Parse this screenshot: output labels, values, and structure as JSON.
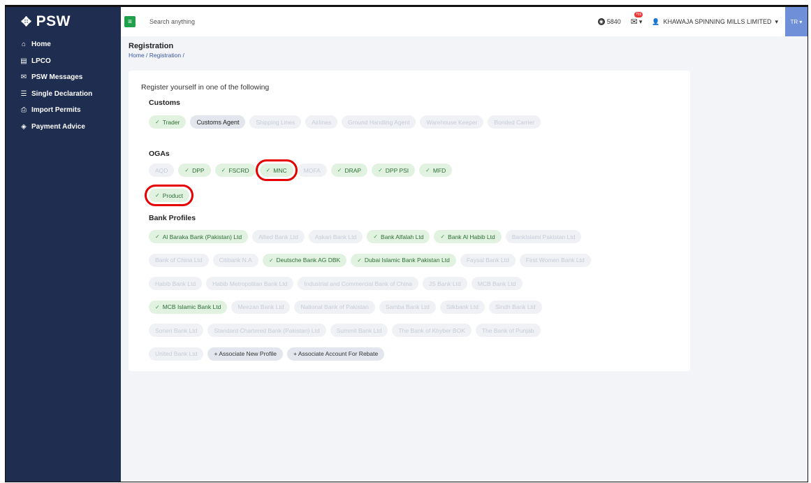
{
  "sidebar": {
    "logo": "PSW",
    "items": [
      {
        "icon": "home-icon",
        "glyph": "⌂",
        "label": "Home"
      },
      {
        "icon": "document-icon",
        "glyph": "▤",
        "label": "LPCO"
      },
      {
        "icon": "messages-icon",
        "glyph": "✉",
        "label": "PSW Messages"
      },
      {
        "icon": "declaration-icon",
        "glyph": "☰",
        "label": "Single Declaration"
      },
      {
        "icon": "import-icon",
        "glyph": "⎙",
        "label": "Import Permits"
      },
      {
        "icon": "payment-icon",
        "glyph": "◈",
        "label": "Payment Advice"
      }
    ]
  },
  "topbar": {
    "search_placeholder": "Search anything",
    "coins": "5840",
    "notification_badge": "759",
    "user": "KHAWAJA SPINNING MILLS LIMITED",
    "avatar": "TR"
  },
  "page": {
    "title": "Registration",
    "breadcrumb": "Home / Registration /"
  },
  "registration": {
    "intro": "Register yourself in one of the following",
    "customs": {
      "heading": "Customs",
      "items": [
        {
          "label": "Trader",
          "state": "registered"
        },
        {
          "label": "Customs Agent",
          "state": "selectable"
        },
        {
          "label": "Shipping Lines",
          "state": "disabled"
        },
        {
          "label": "Airlines",
          "state": "disabled"
        },
        {
          "label": "Ground Handling Agent",
          "state": "disabled"
        },
        {
          "label": "Warehouse Keeper",
          "state": "disabled"
        },
        {
          "label": "Bonded Carrier",
          "state": "disabled"
        }
      ]
    },
    "ogas": {
      "heading": "OGAs",
      "items": [
        {
          "label": "AQD",
          "state": "disabled"
        },
        {
          "label": "DPP",
          "state": "registered"
        },
        {
          "label": "FSCRD",
          "state": "registered"
        },
        {
          "label": "MNC",
          "state": "registered",
          "highlighted": true
        },
        {
          "label": "MOFA",
          "state": "disabled"
        },
        {
          "label": "DRAP",
          "state": "registered"
        },
        {
          "label": "DPP PSI",
          "state": "registered"
        },
        {
          "label": "MFD",
          "state": "registered"
        },
        {
          "label": "Product",
          "state": "registered",
          "highlighted": true
        }
      ]
    },
    "banks": {
      "heading": "Bank Profiles",
      "rows": [
        [
          {
            "label": "Al Baraka Bank (Pakistan) Ltd",
            "state": "registered"
          },
          {
            "label": "Allied Bank Ltd",
            "state": "disabled"
          },
          {
            "label": "Askari Bank Ltd",
            "state": "disabled"
          },
          {
            "label": "Bank Alfalah Ltd",
            "state": "registered"
          },
          {
            "label": "Bank Al Habib Ltd",
            "state": "registered"
          },
          {
            "label": "BankIslami Pakistan Ltd",
            "state": "disabled"
          }
        ],
        [
          {
            "label": "Bank of China Ltd",
            "state": "disabled"
          },
          {
            "label": "Citibank N.A",
            "state": "disabled"
          },
          {
            "label": "Deutsche Bank AG DBK",
            "state": "registered"
          },
          {
            "label": "Dubai Islamic Bank Pakistan Ltd",
            "state": "registered"
          },
          {
            "label": "Faysal Bank Ltd",
            "state": "disabled"
          },
          {
            "label": "First Women Bank Ltd",
            "state": "disabled"
          }
        ],
        [
          {
            "label": "Habib Bank Ltd",
            "state": "disabled"
          },
          {
            "label": "Habib Metropolitan Bank Ltd",
            "state": "disabled"
          },
          {
            "label": "Industrial and Commercial Bank of China",
            "state": "disabled"
          },
          {
            "label": "JS Bank Ltd",
            "state": "disabled"
          },
          {
            "label": "MCB Bank Ltd",
            "state": "disabled"
          }
        ],
        [
          {
            "label": "MCB Islamic Bank Ltd",
            "state": "registered"
          },
          {
            "label": "Meezan Bank Ltd",
            "state": "disabled"
          },
          {
            "label": "National Bank of Pakistan",
            "state": "disabled"
          },
          {
            "label": "Samba Bank Ltd",
            "state": "disabled"
          },
          {
            "label": "Silkbank Ltd",
            "state": "disabled"
          },
          {
            "label": "Sindh Bank Ltd",
            "state": "disabled"
          }
        ],
        [
          {
            "label": "Soneri Bank Ltd",
            "state": "disabled"
          },
          {
            "label": "Standard Chartered Bank (Pakistan) Ltd",
            "state": "disabled"
          },
          {
            "label": "Summit Bank Ltd",
            "state": "disabled"
          },
          {
            "label": "The Bank of Khyber BOK",
            "state": "disabled"
          },
          {
            "label": "The Bank of Punjab",
            "state": "disabled"
          }
        ],
        [
          {
            "label": "United Bank Ltd",
            "state": "disabled"
          },
          {
            "label": "+ Associate New Profile",
            "state": "action"
          },
          {
            "label": "+ Associate Account For Rebate",
            "state": "action"
          }
        ]
      ]
    }
  },
  "colors": {
    "sidebar": "#1f2d50",
    "registered_bg": "#e1f2e1",
    "registered_text": "#2d6e36",
    "highlight": "#e60000",
    "menu_button": "#21a04b"
  }
}
